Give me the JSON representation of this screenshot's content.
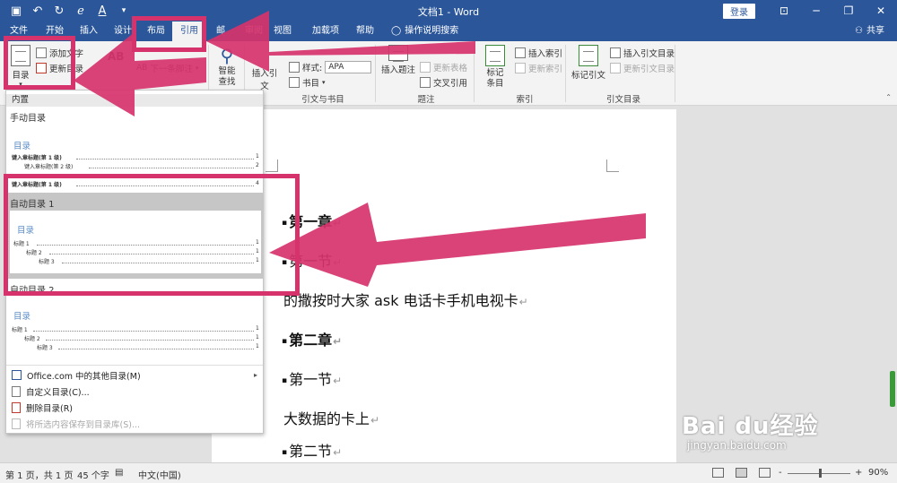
{
  "app": {
    "doc_title": "文档1 - Word",
    "login_label": "登录",
    "share_label": "共享",
    "tell_me": "操作说明搜索"
  },
  "tabs": [
    "文件",
    "开始",
    "插入",
    "设计",
    "布局",
    "引用",
    "邮",
    "审阅",
    "视图",
    "加载项",
    "帮助"
  ],
  "ribbon": {
    "toc_label": "目录",
    "add_text": "添加文字",
    "update_toc": "更新目录",
    "footnote_next": "下一条脚注",
    "smart_lookup": "智能查找",
    "insert_citation": "插入引文",
    "style_label": "样式:",
    "style_value": "APA",
    "bibliography": "书目",
    "group_citations": "引文与书目",
    "insert_caption": "插入题注",
    "update_table": "更新表格",
    "cross_reference": "交叉引用",
    "group_captions": "题注",
    "mark_entry": "标记条目",
    "insert_index": "插入索引",
    "update_index": "更新索引",
    "group_index": "索引",
    "mark_citation": "标记引文",
    "insert_toa": "插入引文目录",
    "update_toa": "更新引文目录",
    "group_toa": "引文目录"
  },
  "dropdown": {
    "section_builtin": "内置",
    "manual_title": "手动目录",
    "manual_head": "目录",
    "manual_entries": [
      {
        "text": "键入章标题(第 1 级)",
        "num": "1"
      },
      {
        "text": "键入章标题(第 2 级)",
        "num": "2"
      },
      {
        "text": "键入章标题(第 1 级)",
        "num": "4"
      }
    ],
    "auto1_title": "自动目录 1",
    "auto1_head": "目录",
    "auto1_entries": [
      {
        "text": "标题 1",
        "num": "1"
      },
      {
        "text": "标题 2",
        "num": "1"
      },
      {
        "text": "标题 3",
        "num": "1"
      }
    ],
    "auto2_title": "自动目录 2",
    "auto2_head": "目录",
    "auto2_entries": [
      {
        "text": "标题 1",
        "num": "1"
      },
      {
        "text": "标题 2",
        "num": "1"
      },
      {
        "text": "标题 3",
        "num": "1"
      }
    ],
    "menu_more": "Office.com 中的其他目录(M)",
    "menu_custom": "自定义目录(C)...",
    "menu_delete": "删除目录(R)",
    "menu_save": "将所选内容保存到目录库(S)..."
  },
  "document": {
    "lines": [
      {
        "text": "第一章",
        "bold": true,
        "bullet": true
      },
      {
        "text": "第一节",
        "bold": false,
        "bullet": true
      },
      {
        "text": "的撒按时大家 ask 电话卡手机电视卡",
        "bold": false,
        "bullet": false
      },
      {
        "text": "第二章",
        "bold": true,
        "bullet": true
      },
      {
        "text": "第一节",
        "bold": false,
        "bullet": true
      },
      {
        "text": "大数据的卡上",
        "bold": false,
        "bullet": false
      },
      {
        "text": "第二节",
        "bold": false,
        "bullet": true
      }
    ],
    "para_mark": "↵"
  },
  "status": {
    "page": "第 1 页，共 1 页",
    "words": "45 个字",
    "language": "中文(中国)",
    "zoom_minus": "-",
    "zoom_plus": "+",
    "zoom": "90%"
  },
  "watermark": {
    "brand": "Bai du经验",
    "url": "jingyan.baidu.com"
  },
  "colors": {
    "accent": "#2b579a",
    "annotation": "#d6336c"
  }
}
